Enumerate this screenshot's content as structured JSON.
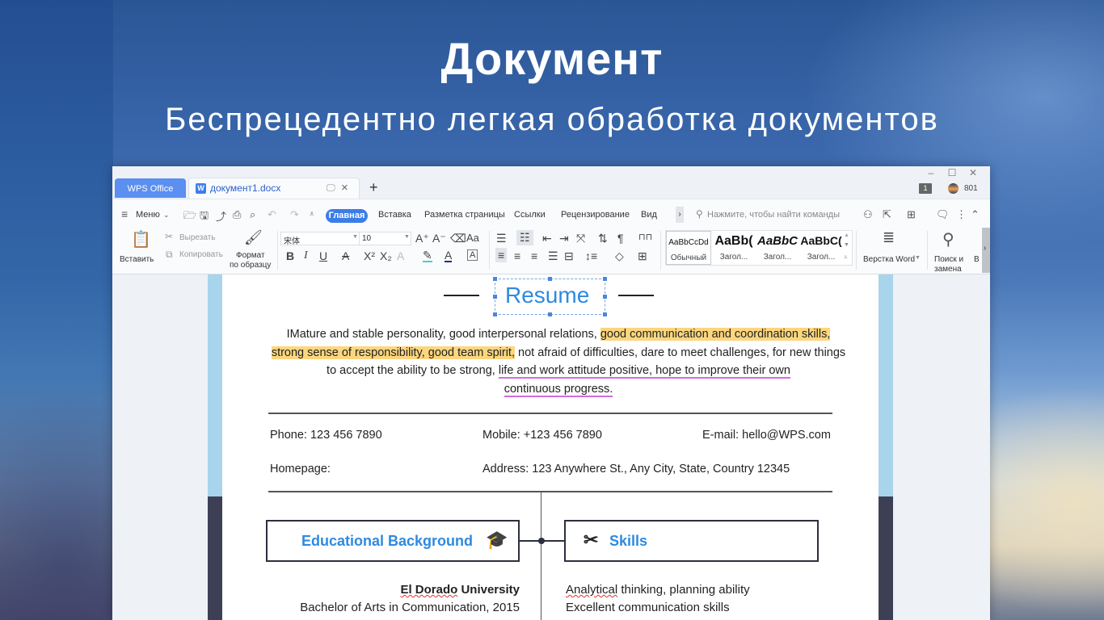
{
  "hero": {
    "title": "Документ",
    "subtitle": "Беспрецедентно легкая обработка документов"
  },
  "titlebar": {
    "home_tab": "WPS Office",
    "doc_tab": "документ1.docx",
    "doc_tab_icon": "W",
    "add_tab": "+",
    "window_controls": [
      "–",
      "☐",
      "✕"
    ],
    "page_badge": "1",
    "user_count": "801"
  },
  "menubar": {
    "menu_label": "Меню",
    "tabs": [
      "Главная",
      "Вставка",
      "Разметка страницы",
      "Ссылки",
      "Рецензирование",
      "Вид"
    ],
    "active_tab": "Главная",
    "search_placeholder": "Нажмите, чтобы найти команды"
  },
  "ribbon": {
    "paste": "Вставить",
    "cut": "Вырезать",
    "copy": "Копировать",
    "format_painter_line1": "Формат",
    "format_painter_line2": "по образцу",
    "font_name": "宋体",
    "font_size": "10",
    "styles": [
      {
        "preview": "AaBbCcDd",
        "label": "Обычный"
      },
      {
        "preview": "AaBb(",
        "label": "Загол..."
      },
      {
        "preview": "AaBbC",
        "label": "Загол..."
      },
      {
        "preview": "AaBbC(",
        "label": "Загол..."
      }
    ],
    "word_layout": "Верстка Word",
    "find_replace_line1": "Поиск и",
    "find_replace_line2": "замена",
    "more": "В"
  },
  "document": {
    "title": "Resume",
    "summary": {
      "part1": "IMature and stable personality, good interpersonal relations, ",
      "highlight1": "good communication and coordination skills,",
      "highlight2": "strong sense of responsibility, good team spirit,",
      "part2": " not afraid of difficulties, dare to meet challenges, for new things to accept the ability to be strong, ",
      "underlined1": "life and work attitude positive, hope to improve their own",
      "underlined2": "continuous progress."
    },
    "contact": {
      "phone": "Phone: 123 456 7890",
      "mobile": "Mobile: +123 456 7890",
      "email": "E-mail: hello@WPS.com",
      "homepage": "Homepage:",
      "address": "Address: 123 Anywhere St., Any City, State, Country 12345"
    },
    "education": {
      "heading": "Educational Background",
      "university_a": "El Dorado",
      "university_b": " University",
      "degree": "Bachelor of Arts in Communication, 2015"
    },
    "skills": {
      "heading": "Skills",
      "items": [
        {
          "a": "Analytical",
          "b": " thinking, planning ability"
        },
        {
          "a": "",
          "b": "Excellent communication skills"
        }
      ]
    }
  },
  "colors": {
    "accent": "#3b7de8",
    "heading_blue": "#2d8ae0",
    "highlight": "#fcd67e",
    "underline": "#d36be0",
    "band_light": "#a8d4ec",
    "band_dark": "#3d4055"
  }
}
